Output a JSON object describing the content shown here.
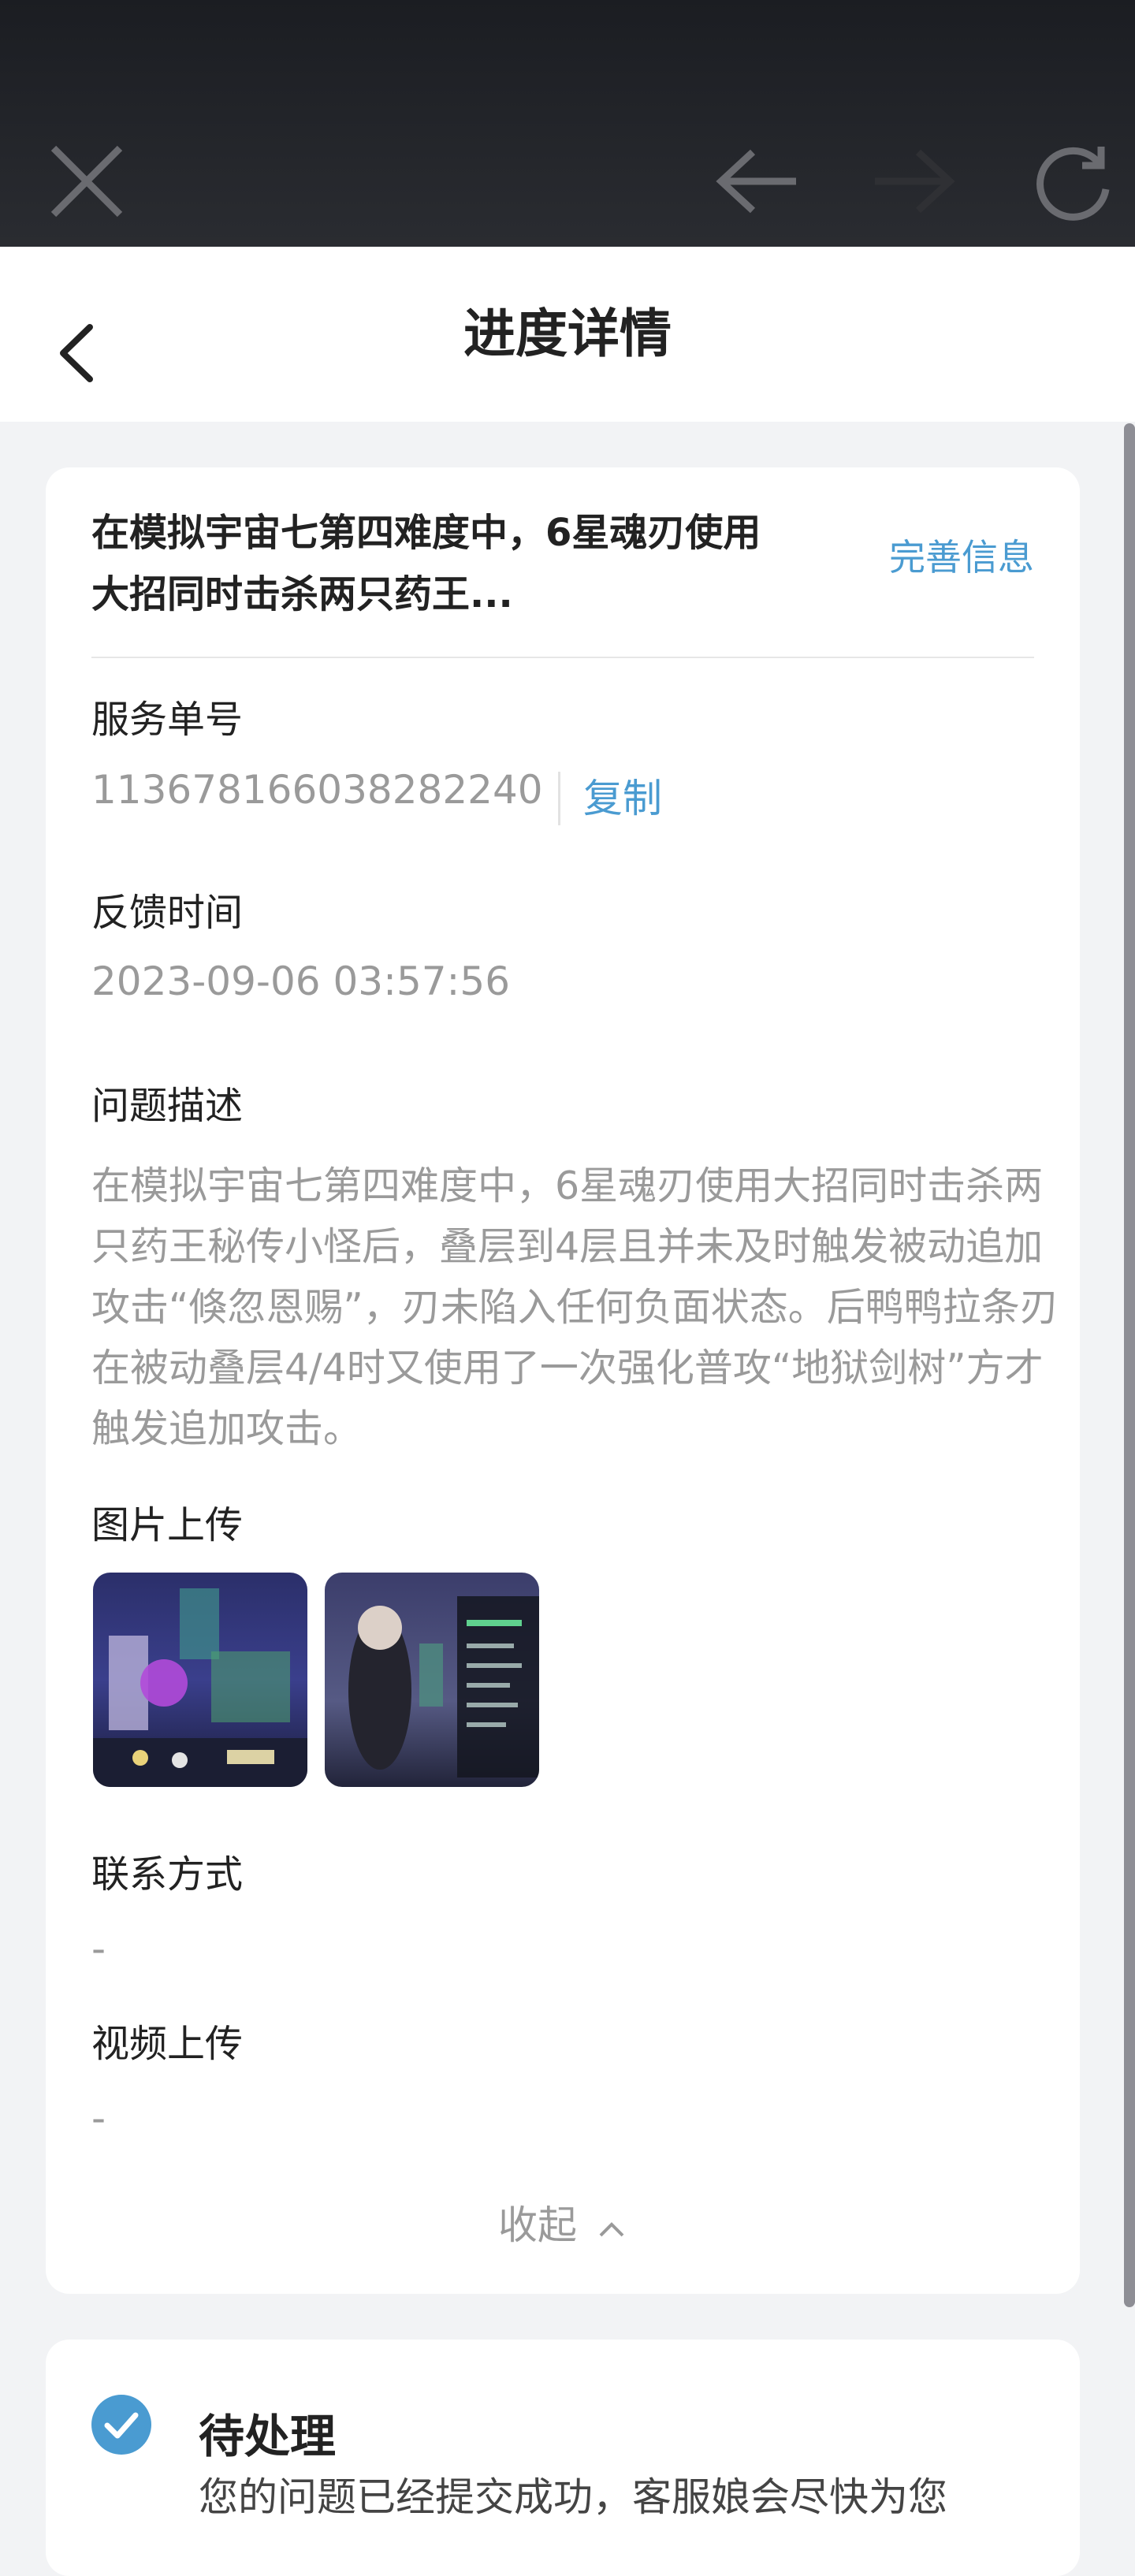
{
  "navbar": {
    "title": "进度详情"
  },
  "ticket": {
    "heading": "在模拟宇宙七第四难度中，6星魂刃使用大招同时击杀两只药王...",
    "complete_info_link": "完善信息",
    "service_no_label": "服务单号",
    "service_no": "1136781660382822​40",
    "copy_label": "复制",
    "feedback_time_label": "反馈时间",
    "feedback_time": "2023-09-06 03:57:56",
    "description_label": "问题描述",
    "description": "在模拟宇宙七第四难度中，6星魂刃使用大招同时击杀两只药王秘传小怪后，叠层到4层且并未及时触发被动追加攻击“倏忽恩赐”，刃未陷入任何负面状态。后鸭鸭拉条刃在被动叠层4/4时又使用了一次强化普攻“地狱剑树”方才触发追加攻击。",
    "images_label": "图片上传",
    "contact_label": "联系方式",
    "contact_value": "-",
    "video_label": "视频上传",
    "video_value": "-",
    "collapse_label": "收起"
  },
  "progress": {
    "status": "待处理",
    "message": "您的问题已经提交成功，客服娘会尽快为您"
  },
  "colors": {
    "accent": "#4a9bd1",
    "muted_text": "#9a9a9a",
    "page_bg": "#f2f3f5",
    "topbar_bg": "#1b1d22"
  }
}
